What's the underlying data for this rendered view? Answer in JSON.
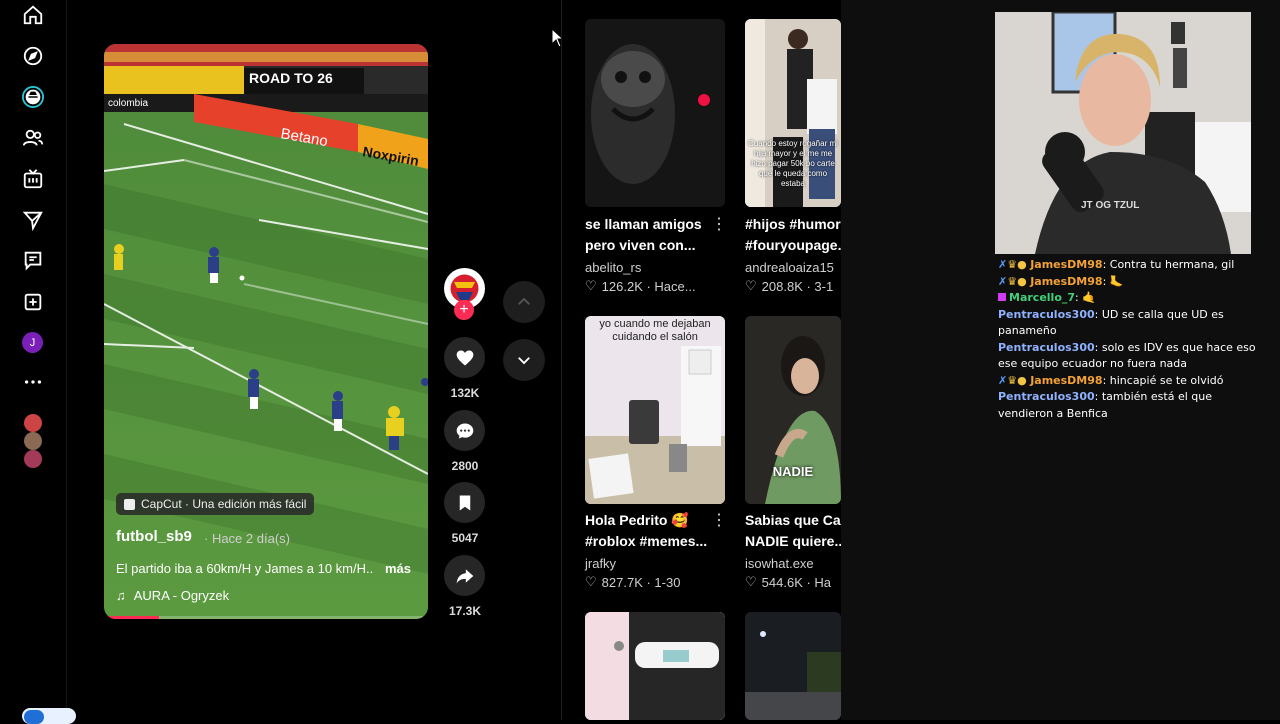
{
  "video": {
    "caption_pill": "CapCut · Una edición más fácil",
    "author": "futbol_sb9",
    "time": "· Hace 2 día(s)",
    "description": "El partido iba a 60km/H y James a 10 km/H..",
    "more_label": "más",
    "music": "AURA - Ogryzek",
    "banners": [
      "ROAD TO 26",
      "colombia",
      "Betano",
      "Noxpirin"
    ],
    "progress": 0.17
  },
  "actions": {
    "likes": "132K",
    "comments": "2800",
    "saves": "5047",
    "shares": "17.3K"
  },
  "grid": {
    "cards": [
      {
        "title": "se llaman amigos",
        "title2": "pero viven con...",
        "author": "abelito_rs",
        "stats": "126.2K · Hace..."
      },
      {
        "title": "#hijos #humor",
        "title2": "#fouryoupage.",
        "author": "andrealoaiza15",
        "stats": "208.8K · 3-1",
        "overlay": "Cuando estoy rogañar mi hija mayor y el me me hizo pagar 50k po carte que le queda como estaba"
      },
      {
        "title": "Hola Pedrito 🥰",
        "title2": "#roblox #memes...",
        "author": "jrafky",
        "stats": "827.7K · 1-30",
        "overlay": "yo cuando me dejaban cuidando el salón"
      },
      {
        "title": "Sabias que Ca:",
        "title2": "NADIE quiere...",
        "author": "isowhat.exe",
        "stats": "544.6K · Ha",
        "overlay": "NADIE"
      }
    ]
  },
  "stream": {
    "chat": [
      {
        "user": "JamesDM98",
        "color": "#f4a236",
        "badges": true,
        "text": "Contra tu hermana, gil"
      },
      {
        "user": "JamesDM98",
        "color": "#f4a236",
        "badges": true,
        "text": "🦶"
      },
      {
        "user": "Marcello_7",
        "color": "#3fd07a",
        "badges": false,
        "badge_square": true,
        "text": "🤙"
      },
      {
        "user": "Pentraculos300",
        "color": "#8fb2ff",
        "badges": false,
        "text": "UD se calla que UD es panameño"
      },
      {
        "user": "Pentraculos300",
        "color": "#8fb2ff",
        "badges": false,
        "text": "solo es IDV es que hace eso ese equipo ecuador no fuera nada"
      },
      {
        "user": "JamesDM98",
        "color": "#f4a236",
        "badges": true,
        "text": "hincapié se te olvidó"
      },
      {
        "user": "Pentraculos300",
        "color": "#8fb2ff",
        "badges": false,
        "text": "también está el que vendieron a Benfica"
      }
    ],
    "shirt_text": "JT OG TZUL"
  },
  "rail": {
    "avatar_letter": "J",
    "icons": [
      "home-icon",
      "explore-icon",
      "following-icon",
      "friends-icon",
      "live-icon",
      "messages-icon",
      "inbox-icon",
      "upload-icon",
      "profile-icon",
      "more-icon"
    ]
  },
  "colors": {
    "accent": "#fe2c55",
    "background": "#000000"
  }
}
